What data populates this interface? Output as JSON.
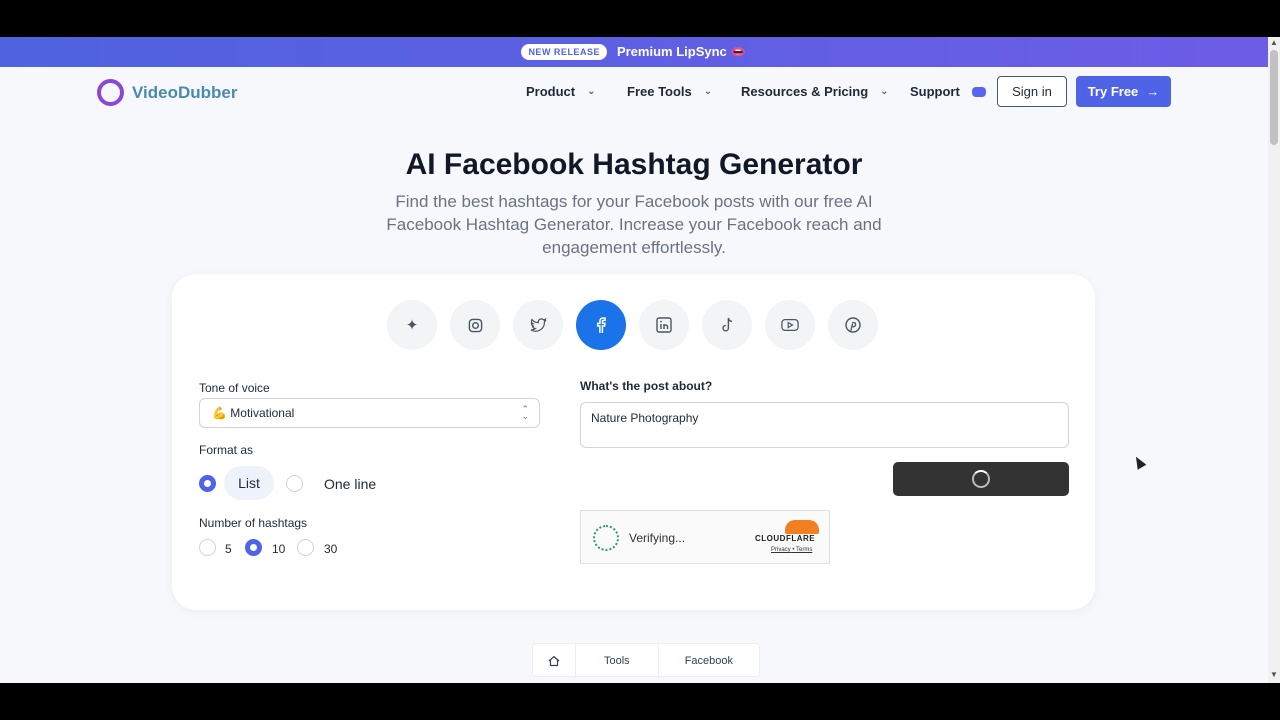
{
  "banner": {
    "badge": "NEW RELEASE",
    "text": "Premium LipSync 👄"
  },
  "brand": {
    "name": "VideoDubber"
  },
  "nav": {
    "product": "Product",
    "free_tools": "Free Tools",
    "resources": "Resources & Pricing",
    "support": "Support",
    "sign_in": "Sign in",
    "try_free": "Try Free"
  },
  "hero": {
    "title": "AI Facebook Hashtag Generator",
    "subtitle": "Find the best hashtags for your Facebook posts with our free AI Facebook Hashtag Generator. Increase your Facebook reach and engagement effortlessly."
  },
  "platforms": [
    "sparkles-icon",
    "instagram-icon",
    "twitter-icon",
    "facebook-icon",
    "linkedin-icon",
    "tiktok-icon",
    "youtube-icon",
    "pinterest-icon"
  ],
  "active_platform": "facebook-icon",
  "form": {
    "tone_label": "Tone of voice",
    "tone_value": "💪 Motivational",
    "format_label": "Format as",
    "format_list": "List",
    "format_oneline": "One line",
    "format_selected": "List",
    "count_label": "Number of hashtags",
    "count_options": [
      "5",
      "10",
      "30"
    ],
    "count_selected": "10",
    "post_label": "What's the post about?",
    "post_value": "Nature Photography"
  },
  "captcha": {
    "status": "Verifying...",
    "brand": "CLOUDFLARE",
    "privacy": "Privacy",
    "terms": "Terms"
  },
  "breadcrumb": {
    "tools": "Tools",
    "facebook": "Facebook"
  },
  "colors": {
    "accent": "#4e63e6",
    "facebook": "#1a73e8",
    "brand_ring": "#8b48d6"
  }
}
